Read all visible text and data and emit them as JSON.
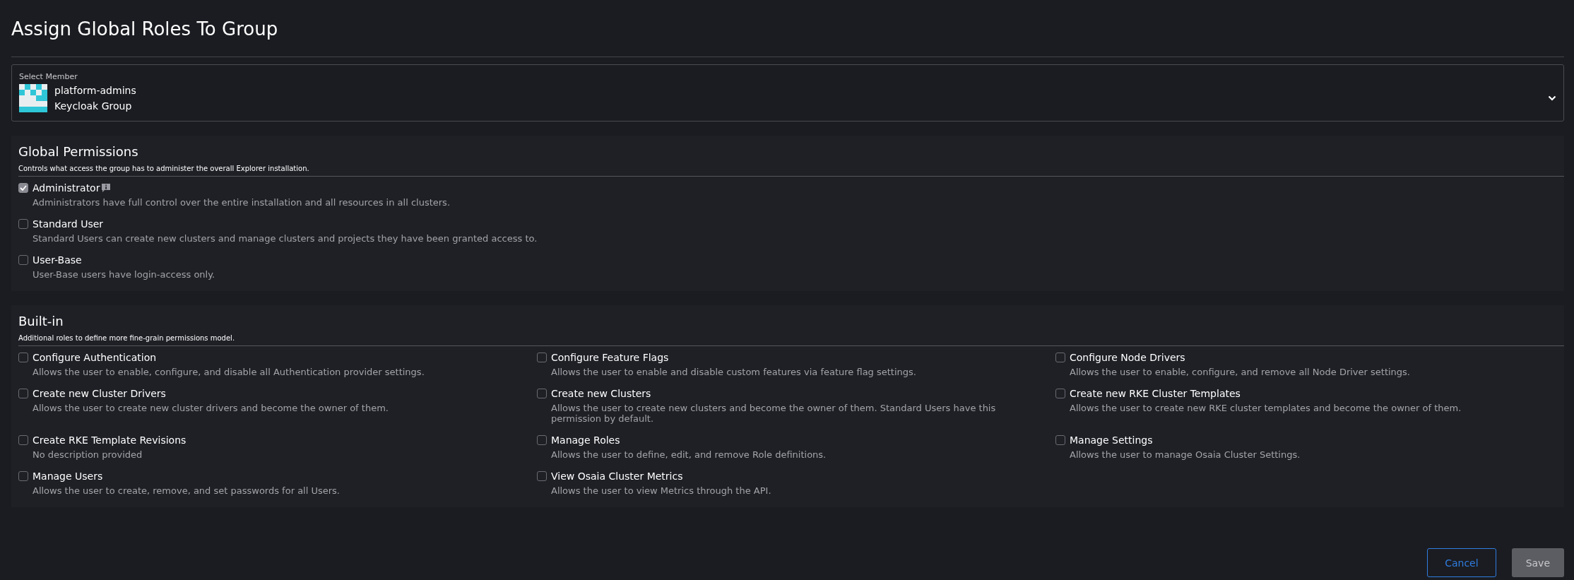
{
  "title": "Assign Global Roles To Group",
  "member_select": {
    "label": "Select Member",
    "name": "platform-admins",
    "type": "Keycloak Group"
  },
  "sections": [
    {
      "title": "Global Permissions",
      "description": "Controls what access the group has to administer the overall Explorer installation.",
      "kind": "list",
      "roles": [
        {
          "label": "Administrator",
          "description": "Administrators have full control over the entire installation and all resources in all clusters.",
          "checked": true,
          "info": true
        },
        {
          "label": "Standard User",
          "description": "Standard Users can create new clusters and manage clusters and projects they have been granted access to.",
          "checked": false,
          "info": false
        },
        {
          "label": "User-Base",
          "description": "User-Base users have login-access only.",
          "checked": false,
          "info": false
        }
      ]
    },
    {
      "title": "Built-in",
      "description": "Additional roles to define more fine-grain permissions model.",
      "kind": "grid",
      "roles": [
        {
          "label": "Configure Authentication",
          "description": "Allows the user to enable, configure, and disable all Authentication provider settings.",
          "checked": false,
          "info": false
        },
        {
          "label": "Configure Feature Flags",
          "description": "Allows the user to enable and disable custom features via feature flag settings.",
          "checked": false,
          "info": false
        },
        {
          "label": "Configure Node Drivers",
          "description": "Allows the user to enable, configure, and remove all Node Driver settings.",
          "checked": false,
          "info": false
        },
        {
          "label": "Create new Cluster Drivers",
          "description": "Allows the user to create new cluster drivers and become the owner of them.",
          "checked": false,
          "info": false
        },
        {
          "label": "Create new Clusters",
          "description": "Allows the user to create new clusters and become the owner of them. Standard Users have this permission by default.",
          "checked": false,
          "info": false
        },
        {
          "label": "Create new RKE Cluster Templates",
          "description": "Allows the user to create new RKE cluster templates and become the owner of them.",
          "checked": false,
          "info": false
        },
        {
          "label": "Create RKE Template Revisions",
          "description": "No description provided",
          "checked": false,
          "info": false
        },
        {
          "label": "Manage Roles",
          "description": "Allows the user to define, edit, and remove Role definitions.",
          "checked": false,
          "info": false
        },
        {
          "label": "Manage Settings",
          "description": "Allows the user to manage Osaia Cluster Settings.",
          "checked": false,
          "info": false
        },
        {
          "label": "Manage Users",
          "description": "Allows the user to create, remove, and set passwords for all Users.",
          "checked": false,
          "info": false
        },
        {
          "label": "View Osaia Cluster Metrics",
          "description": "Allows the user to view Metrics through the API.",
          "checked": false,
          "info": false
        }
      ]
    }
  ],
  "buttons": [
    {
      "label": "Cancel",
      "kind": "outline",
      "disabled": false
    },
    {
      "label": "Save",
      "kind": "primary",
      "disabled": true
    }
  ]
}
